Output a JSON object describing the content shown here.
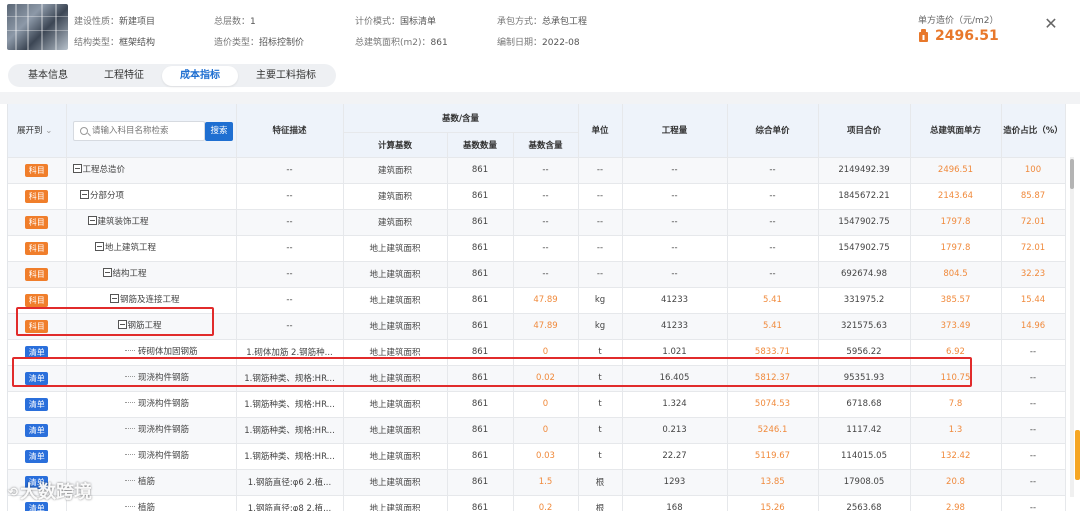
{
  "header": {
    "info": [
      {
        "label": "建设性质：",
        "value": "新建项目"
      },
      {
        "label": "总层数：",
        "value": "1"
      },
      {
        "label": "计价模式：",
        "value": "国标清单"
      },
      {
        "label": "承包方式：",
        "value": "总承包工程"
      },
      {
        "label": "结构类型：",
        "value": "框架结构"
      },
      {
        "label": "造价类型：",
        "value": "招标控制价"
      },
      {
        "label": "总建筑面积(m2)：",
        "value": "861"
      },
      {
        "label": "编制日期：",
        "value": "2022-08"
      }
    ],
    "price_label": "单方造价（元/m2）",
    "price_value": "2496.51",
    "close": "✕"
  },
  "tabs": [
    "基本信息",
    "工程特征",
    "成本指标",
    "主要工料指标"
  ],
  "active_tab": "成本指标",
  "table": {
    "expand_label": "展开到",
    "search_placeholder": "请输入科目名称检索",
    "search_button": "搜索",
    "headers": {
      "feature": "特征描述",
      "base_group": "基数/含量",
      "calc_base": "计算基数",
      "base_qty": "基数数量",
      "base_content": "基数含量",
      "unit": "单位",
      "quantity": "工程量",
      "unit_price": "综合单价",
      "total": "项目合价",
      "area_price": "总建筑面单方",
      "cost_ratio": "造价占比（%）"
    },
    "badges": {
      "ke": "科目",
      "qd": "清单"
    },
    "rows": [
      {
        "badge": "ke",
        "level": 0,
        "expand": true,
        "name": "工程总造价",
        "feature": "--",
        "base": "建筑面积",
        "base_qty": "861",
        "content": "--",
        "unit": "--",
        "qty": "--",
        "price": "--",
        "total": "2149492.39",
        "area": "2496.51",
        "ratio": "100"
      },
      {
        "badge": "ke",
        "level": 1,
        "expand": true,
        "name": "分部分项",
        "feature": "--",
        "base": "建筑面积",
        "base_qty": "861",
        "content": "--",
        "unit": "--",
        "qty": "--",
        "price": "--",
        "total": "1845672.21",
        "area": "2143.64",
        "ratio": "85.87"
      },
      {
        "badge": "ke",
        "level": 2,
        "expand": true,
        "name": "建筑装饰工程",
        "feature": "--",
        "base": "建筑面积",
        "base_qty": "861",
        "content": "--",
        "unit": "--",
        "qty": "--",
        "price": "--",
        "total": "1547902.75",
        "area": "1797.8",
        "ratio": "72.01"
      },
      {
        "badge": "ke",
        "level": 3,
        "expand": true,
        "name": "地上建筑工程",
        "feature": "--",
        "base": "地上建筑面积",
        "base_qty": "861",
        "content": "--",
        "unit": "--",
        "qty": "--",
        "price": "--",
        "total": "1547902.75",
        "area": "1797.8",
        "ratio": "72.01"
      },
      {
        "badge": "ke",
        "level": 4,
        "expand": true,
        "name": "结构工程",
        "feature": "--",
        "base": "地上建筑面积",
        "base_qty": "861",
        "content": "--",
        "unit": "--",
        "qty": "--",
        "price": "--",
        "total": "692674.98",
        "area": "804.5",
        "ratio": "32.23"
      },
      {
        "badge": "ke",
        "level": 5,
        "expand": true,
        "name": "钢筋及连接工程",
        "feature": "--",
        "base": "地上建筑面积",
        "base_qty": "861",
        "content": "47.89",
        "unit": "kg",
        "qty": "41233",
        "price": "5.41",
        "total": "331975.2",
        "area": "385.57",
        "ratio": "15.44"
      },
      {
        "badge": "ke",
        "level": 6,
        "expand": true,
        "name": "钢筋工程",
        "feature": "--",
        "base": "地上建筑面积",
        "base_qty": "861",
        "content": "47.89",
        "unit": "kg",
        "qty": "41233",
        "price": "5.41",
        "total": "321575.63",
        "area": "373.49",
        "ratio": "14.96"
      },
      {
        "badge": "qd",
        "level": 7,
        "expand": false,
        "name": "砖砌体加固钢筋",
        "feature": "1.砌体加筋 2.钢筋种...",
        "base": "地上建筑面积",
        "base_qty": "861",
        "content": "0",
        "unit": "t",
        "qty": "1.021",
        "price": "5833.71",
        "total": "5956.22",
        "area": "6.92",
        "ratio": "--"
      },
      {
        "badge": "qd",
        "level": 7,
        "expand": false,
        "name": "现浇构件钢筋",
        "feature": "1.钢筋种类、规格:HR...",
        "base": "地上建筑面积",
        "base_qty": "861",
        "content": "0.02",
        "unit": "t",
        "qty": "16.405",
        "price": "5812.37",
        "total": "95351.93",
        "area": "110.75",
        "ratio": "--"
      },
      {
        "badge": "qd",
        "level": 7,
        "expand": false,
        "name": "现浇构件钢筋",
        "feature": "1.钢筋种类、规格:HR...",
        "base": "地上建筑面积",
        "base_qty": "861",
        "content": "0",
        "unit": "t",
        "qty": "1.324",
        "price": "5074.53",
        "total": "6718.68",
        "area": "7.8",
        "ratio": "--"
      },
      {
        "badge": "qd",
        "level": 7,
        "expand": false,
        "name": "现浇构件钢筋",
        "feature": "1.钢筋种类、规格:HR...",
        "base": "地上建筑面积",
        "base_qty": "861",
        "content": "0",
        "unit": "t",
        "qty": "0.213",
        "price": "5246.1",
        "total": "1117.42",
        "area": "1.3",
        "ratio": "--"
      },
      {
        "badge": "qd",
        "level": 7,
        "expand": false,
        "name": "现浇构件钢筋",
        "feature": "1.钢筋种类、规格:HR...",
        "base": "地上建筑面积",
        "base_qty": "861",
        "content": "0.03",
        "unit": "t",
        "qty": "22.27",
        "price": "5119.67",
        "total": "114015.05",
        "area": "132.42",
        "ratio": "--"
      },
      {
        "badge": "qd",
        "level": 7,
        "expand": false,
        "name": "植筋",
        "feature": "1.钢筋直径:φ6 2.植...",
        "base": "地上建筑面积",
        "base_qty": "861",
        "content": "1.5",
        "unit": "根",
        "qty": "1293",
        "price": "13.85",
        "total": "17908.05",
        "area": "20.8",
        "ratio": "--"
      },
      {
        "badge": "qd",
        "level": 7,
        "expand": false,
        "name": "植筋",
        "feature": "1.钢筋直径:φ8 2.植...",
        "base": "地上建筑面积",
        "base_qty": "861",
        "content": "0.2",
        "unit": "根",
        "qty": "168",
        "price": "15.26",
        "total": "2563.68",
        "area": "2.98",
        "ratio": "--"
      }
    ]
  },
  "watermark": "大数跨境",
  "colors": {
    "accent": "#1f6fd1",
    "orange": "#e8782b",
    "badge_ke": "#f07e2b",
    "badge_qd": "#2a6fdb",
    "highlight": "#e12b2b"
  }
}
